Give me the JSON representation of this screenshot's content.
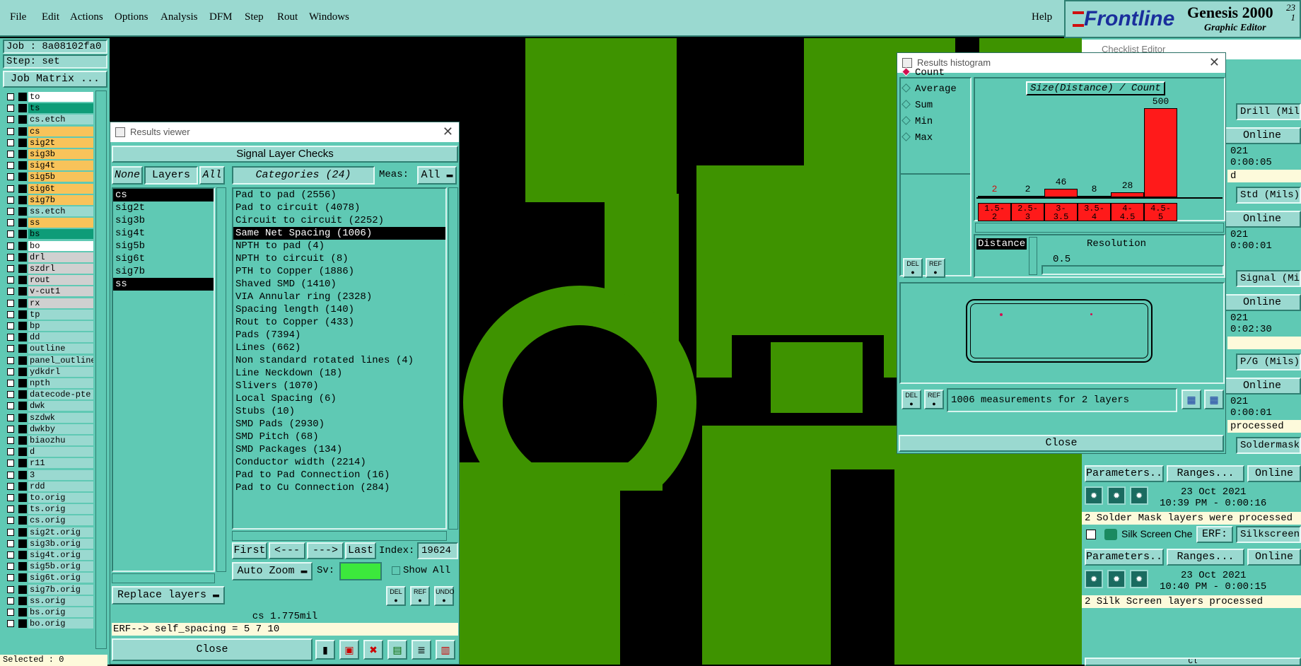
{
  "menu": {
    "items": [
      "File",
      "Edit",
      "Actions",
      "Options",
      "Analysis",
      "DFM",
      "Step",
      "Rout",
      "Windows"
    ],
    "help": "Help"
  },
  "brand": {
    "logo": "Frontline",
    "product": "Genesis 2000",
    "version": "23\n1",
    "subtitle": "Graphic Editor"
  },
  "job": {
    "job_label": "Job : 8a08102fa0",
    "step_label": "Step: set",
    "matrix_button": "Job Matrix ...",
    "selected": "Selected : 0"
  },
  "layers": [
    {
      "name": "to",
      "color": "#ffffff"
    },
    {
      "name": "ts",
      "color": "#0e9c78"
    },
    {
      "name": "cs.etch",
      "color": "#9ad9d0"
    },
    {
      "name": "cs",
      "color": "#f8c35a"
    },
    {
      "name": "sig2t",
      "color": "#f8c35a"
    },
    {
      "name": "sig3b",
      "color": "#f8c35a"
    },
    {
      "name": "sig4t",
      "color": "#f8c35a"
    },
    {
      "name": "sig5b",
      "color": "#f8c35a"
    },
    {
      "name": "sig6t",
      "color": "#f8c35a"
    },
    {
      "name": "sig7b",
      "color": "#f8c35a"
    },
    {
      "name": "ss.etch",
      "color": "#9ad9d0"
    },
    {
      "name": "ss",
      "color": "#f8c35a"
    },
    {
      "name": "bs",
      "color": "#0e9c78"
    },
    {
      "name": "bo",
      "color": "#ffffff"
    },
    {
      "name": "drl",
      "color": "#d0d0d0"
    },
    {
      "name": "szdrl",
      "color": "#d0d0d0"
    },
    {
      "name": "rout",
      "color": "#d0d0d0"
    },
    {
      "name": "v-cut1",
      "color": "#d0d0d0"
    },
    {
      "name": "rx",
      "color": "#d0d0d0"
    },
    {
      "name": "tp",
      "color": "#9ad9d0"
    },
    {
      "name": "bp",
      "color": "#9ad9d0"
    },
    {
      "name": "dd",
      "color": "#9ad9d0"
    },
    {
      "name": "outline",
      "color": "#9ad9d0"
    },
    {
      "name": "panel_outline",
      "color": "#9ad9d0"
    },
    {
      "name": "ydkdrl",
      "color": "#9ad9d0"
    },
    {
      "name": "npth",
      "color": "#9ad9d0"
    },
    {
      "name": "datecode-pte",
      "color": "#9ad9d0"
    },
    {
      "name": "dwk",
      "color": "#9ad9d0"
    },
    {
      "name": "szdwk",
      "color": "#9ad9d0"
    },
    {
      "name": "dwkby",
      "color": "#9ad9d0"
    },
    {
      "name": "biaozhu",
      "color": "#9ad9d0"
    },
    {
      "name": "d",
      "color": "#9ad9d0"
    },
    {
      "name": "r11",
      "color": "#9ad9d0"
    },
    {
      "name": "3",
      "color": "#9ad9d0"
    },
    {
      "name": "rdd",
      "color": "#9ad9d0"
    },
    {
      "name": "to.orig",
      "color": "#9ad9d0"
    },
    {
      "name": "ts.orig",
      "color": "#9ad9d0"
    },
    {
      "name": "cs.orig",
      "color": "#9ad9d0"
    },
    {
      "name": "sig2t.orig",
      "color": "#9ad9d0"
    },
    {
      "name": "sig3b.orig",
      "color": "#9ad9d0"
    },
    {
      "name": "sig4t.orig",
      "color": "#9ad9d0"
    },
    {
      "name": "sig5b.orig",
      "color": "#9ad9d0"
    },
    {
      "name": "sig6t.orig",
      "color": "#9ad9d0"
    },
    {
      "name": "sig7b.orig",
      "color": "#9ad9d0"
    },
    {
      "name": "ss.orig",
      "color": "#9ad9d0"
    },
    {
      "name": "bs.orig",
      "color": "#9ad9d0"
    },
    {
      "name": "bo.orig",
      "color": "#9ad9d0"
    }
  ],
  "results_viewer": {
    "title": "Results viewer",
    "header": "Signal Layer Checks",
    "btn_none": "None",
    "btn_layers": "Layers",
    "btn_all": "All",
    "categories_button": "Categories (24)",
    "meas_label": "Meas:",
    "meas_value": "All",
    "layer_list": [
      "cs",
      "sig2t",
      "sig3b",
      "sig4t",
      "sig5b",
      "sig6t",
      "sig7b",
      "ss"
    ],
    "categories": [
      "Pad to pad (2556)",
      "Pad to circuit (4078)",
      "Circuit to circuit (2252)",
      "Same Net Spacing (1006)",
      "NPTH to pad (4)",
      "NPTH to circuit (8)",
      "PTH to Copper (1886)",
      "Shaved SMD (1410)",
      "VIA Annular ring (2328)",
      "Spacing length (140)",
      "Rout to Copper (433)",
      "Pads (7394)",
      "Lines (662)",
      "Non standard rotated lines (4)",
      "Line Neckdown (18)",
      "Slivers (1070)",
      "Local Spacing (6)",
      "Stubs (10)",
      "SMD Pads (2930)",
      "SMD Pitch (68)",
      "SMD Packages (134)",
      "Conductor width (2214)",
      "Pad to Pad Connection (16)",
      "Pad to Cu Connection (284)"
    ],
    "nav_first": "First",
    "nav_prev": "<---",
    "nav_next": "--->",
    "nav_last": "Last",
    "index_label": "Index:",
    "index_value": "19624",
    "auto_zoom": "Auto Zoom",
    "sv_label": "Sv:",
    "show_all": "Show All",
    "replace_layers": "Replace layers",
    "btn_del": "DEL",
    "btn_ref": "REF",
    "btn_undo": "UNDO",
    "status": "cs 1.775mil",
    "erf": "ERF--> self_spacing = 5 7 10",
    "close": "Close"
  },
  "histogram": {
    "title": "Results histogram",
    "modes": [
      "Count",
      "Average",
      "Sum",
      "Min",
      "Max"
    ],
    "chart_title": "Size(Distance) / Count",
    "bins": [
      "1.5-\n2",
      "2.5-\n3",
      "3-\n3.5",
      "3.5-\n4",
      "4-\n4.5",
      "4.5-\n5"
    ],
    "counts": [
      2,
      2,
      46,
      8,
      28,
      500
    ],
    "distance_label": "Distance",
    "resolution_label": "Resolution",
    "resolution_value": "0.5",
    "measurements": "1006 measurements for 2 layers",
    "close": "Close",
    "btn_del": "DEL",
    "btn_ref": "REF"
  },
  "checklist": {
    "title": "Checklist Editor",
    "fields": [
      "Drill (Mils)",
      "Std (Mils)",
      "Signal (Mils)",
      "P/G (Mils)",
      "Soldermask",
      "Silkscreen"
    ],
    "times": [
      "021",
      "0:00:05",
      "021",
      "0:00:01",
      "021",
      "0:02:30",
      "021",
      "0:00:01"
    ],
    "status_lines": [
      "d",
      "processed"
    ],
    "online": "Online",
    "params": "Parameters...",
    "ranges": "Ranges...",
    "date1": "23 Oct 2021",
    "time1": "10:39 PM - 0:00:16",
    "msg1": "2 Solder Mask layers were processed",
    "silk_label": "Silk Screen Che",
    "erf_label": "ERF:",
    "date2": "23 Oct 2021",
    "time2": "10:40 PM - 0:00:15",
    "msg2": "2 Silk Screen layers processed",
    "close_partial": "Cl"
  },
  "colors": {
    "ui": "#5fc9b4",
    "ui_light": "#9ad9d0",
    "copper": "#3e9300",
    "bar": "#ff1a1a",
    "signal_layer": "#f8c35a"
  }
}
